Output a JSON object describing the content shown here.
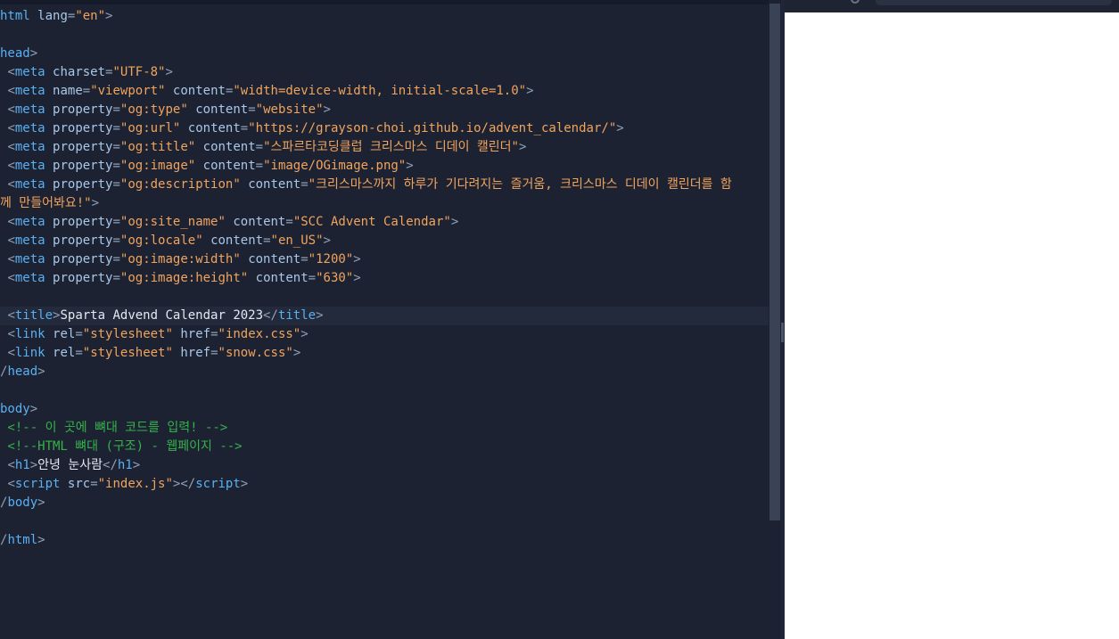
{
  "editor": {
    "lines": [
      [
        [
          "tag",
          "html"
        ],
        [
          "text",
          " "
        ],
        [
          "attr",
          "lang"
        ],
        [
          "punct",
          "="
        ],
        [
          "str",
          "\"en\""
        ],
        [
          "punct",
          ">"
        ]
      ],
      [],
      [
        [
          "tag",
          "head"
        ],
        [
          "punct",
          ">"
        ]
      ],
      [
        [
          "text",
          " "
        ],
        [
          "punct",
          "<"
        ],
        [
          "tag",
          "meta"
        ],
        [
          "text",
          " "
        ],
        [
          "attr",
          "charset"
        ],
        [
          "punct",
          "="
        ],
        [
          "str",
          "\"UTF-8\""
        ],
        [
          "punct",
          ">"
        ]
      ],
      [
        [
          "text",
          " "
        ],
        [
          "punct",
          "<"
        ],
        [
          "tag",
          "meta"
        ],
        [
          "text",
          " "
        ],
        [
          "attr",
          "name"
        ],
        [
          "punct",
          "="
        ],
        [
          "str",
          "\"viewport\""
        ],
        [
          "text",
          " "
        ],
        [
          "attr",
          "content"
        ],
        [
          "punct",
          "="
        ],
        [
          "str",
          "\"width=device-width, initial-scale=1.0\""
        ],
        [
          "punct",
          ">"
        ]
      ],
      [
        [
          "text",
          " "
        ],
        [
          "punct",
          "<"
        ],
        [
          "tag",
          "meta"
        ],
        [
          "text",
          " "
        ],
        [
          "attr",
          "property"
        ],
        [
          "punct",
          "="
        ],
        [
          "str",
          "\"og:type\""
        ],
        [
          "text",
          " "
        ],
        [
          "attr",
          "content"
        ],
        [
          "punct",
          "="
        ],
        [
          "str",
          "\"website\""
        ],
        [
          "punct",
          ">"
        ]
      ],
      [
        [
          "text",
          " "
        ],
        [
          "punct",
          "<"
        ],
        [
          "tag",
          "meta"
        ],
        [
          "text",
          " "
        ],
        [
          "attr",
          "property"
        ],
        [
          "punct",
          "="
        ],
        [
          "str",
          "\"og:url\""
        ],
        [
          "text",
          " "
        ],
        [
          "attr",
          "content"
        ],
        [
          "punct",
          "="
        ],
        [
          "str",
          "\"https://grayson-choi.github.io/advent_calendar/\""
        ],
        [
          "punct",
          ">"
        ]
      ],
      [
        [
          "text",
          " "
        ],
        [
          "punct",
          "<"
        ],
        [
          "tag",
          "meta"
        ],
        [
          "text",
          " "
        ],
        [
          "attr",
          "property"
        ],
        [
          "punct",
          "="
        ],
        [
          "str",
          "\"og:title\""
        ],
        [
          "text",
          " "
        ],
        [
          "attr",
          "content"
        ],
        [
          "punct",
          "="
        ],
        [
          "str",
          "\"스파르타코딩클럽 크리스마스 디데이 캘린더\""
        ],
        [
          "punct",
          ">"
        ]
      ],
      [
        [
          "text",
          " "
        ],
        [
          "punct",
          "<"
        ],
        [
          "tag",
          "meta"
        ],
        [
          "text",
          " "
        ],
        [
          "attr",
          "property"
        ],
        [
          "punct",
          "="
        ],
        [
          "str",
          "\"og:image\""
        ],
        [
          "text",
          " "
        ],
        [
          "attr",
          "content"
        ],
        [
          "punct",
          "="
        ],
        [
          "str",
          "\"image/OGimage.png\""
        ],
        [
          "punct",
          ">"
        ]
      ],
      [
        [
          "text",
          " "
        ],
        [
          "punct",
          "<"
        ],
        [
          "tag",
          "meta"
        ],
        [
          "text",
          " "
        ],
        [
          "attr",
          "property"
        ],
        [
          "punct",
          "="
        ],
        [
          "str",
          "\"og:description\""
        ],
        [
          "text",
          " "
        ],
        [
          "attr",
          "content"
        ],
        [
          "punct",
          "="
        ],
        [
          "str",
          "\"크리스마스까지 하루가 기다려지는 즐거움, 크리스마스 디데이 캘린더를 함"
        ]
      ],
      [
        [
          "str",
          "께 만들어봐요!\""
        ],
        [
          "punct",
          ">"
        ]
      ],
      [
        [
          "text",
          " "
        ],
        [
          "punct",
          "<"
        ],
        [
          "tag",
          "meta"
        ],
        [
          "text",
          " "
        ],
        [
          "attr",
          "property"
        ],
        [
          "punct",
          "="
        ],
        [
          "str",
          "\"og:site_name\""
        ],
        [
          "text",
          " "
        ],
        [
          "attr",
          "content"
        ],
        [
          "punct",
          "="
        ],
        [
          "str",
          "\"SCC Advent Calendar\""
        ],
        [
          "punct",
          ">"
        ]
      ],
      [
        [
          "text",
          " "
        ],
        [
          "punct",
          "<"
        ],
        [
          "tag",
          "meta"
        ],
        [
          "text",
          " "
        ],
        [
          "attr",
          "property"
        ],
        [
          "punct",
          "="
        ],
        [
          "str",
          "\"og:locale\""
        ],
        [
          "text",
          " "
        ],
        [
          "attr",
          "content"
        ],
        [
          "punct",
          "="
        ],
        [
          "str",
          "\"en_US\""
        ],
        [
          "punct",
          ">"
        ]
      ],
      [
        [
          "text",
          " "
        ],
        [
          "punct",
          "<"
        ],
        [
          "tag",
          "meta"
        ],
        [
          "text",
          " "
        ],
        [
          "attr",
          "property"
        ],
        [
          "punct",
          "="
        ],
        [
          "str",
          "\"og:image:width\""
        ],
        [
          "text",
          " "
        ],
        [
          "attr",
          "content"
        ],
        [
          "punct",
          "="
        ],
        [
          "str",
          "\"1200\""
        ],
        [
          "punct",
          ">"
        ]
      ],
      [
        [
          "text",
          " "
        ],
        [
          "punct",
          "<"
        ],
        [
          "tag",
          "meta"
        ],
        [
          "text",
          " "
        ],
        [
          "attr",
          "property"
        ],
        [
          "punct",
          "="
        ],
        [
          "str",
          "\"og:image:height\""
        ],
        [
          "text",
          " "
        ],
        [
          "attr",
          "content"
        ],
        [
          "punct",
          "="
        ],
        [
          "str",
          "\"630\""
        ],
        [
          "punct",
          ">"
        ]
      ],
      [],
      [
        [
          "text",
          " "
        ],
        [
          "punct",
          "<"
        ],
        [
          "tag",
          "title"
        ],
        [
          "punct",
          ">"
        ],
        [
          "text",
          "Sparta Advend Calendar 2023"
        ],
        [
          "punct",
          "</"
        ],
        [
          "tag",
          "title"
        ],
        [
          "punct",
          ">"
        ]
      ],
      [
        [
          "text",
          " "
        ],
        [
          "punct",
          "<"
        ],
        [
          "tag",
          "link"
        ],
        [
          "text",
          " "
        ],
        [
          "attr",
          "rel"
        ],
        [
          "punct",
          "="
        ],
        [
          "str",
          "\"stylesheet\""
        ],
        [
          "text",
          " "
        ],
        [
          "attr",
          "href"
        ],
        [
          "punct",
          "="
        ],
        [
          "str",
          "\"index.css\""
        ],
        [
          "punct",
          ">"
        ]
      ],
      [
        [
          "text",
          " "
        ],
        [
          "punct",
          "<"
        ],
        [
          "tag",
          "link"
        ],
        [
          "text",
          " "
        ],
        [
          "attr",
          "rel"
        ],
        [
          "punct",
          "="
        ],
        [
          "str",
          "\"stylesheet\""
        ],
        [
          "text",
          " "
        ],
        [
          "attr",
          "href"
        ],
        [
          "punct",
          "="
        ],
        [
          "str",
          "\"snow.css\""
        ],
        [
          "punct",
          ">"
        ]
      ],
      [
        [
          "punct",
          "/"
        ],
        [
          "tag",
          "head"
        ],
        [
          "punct",
          ">"
        ]
      ],
      [],
      [
        [
          "tag",
          "body"
        ],
        [
          "punct",
          ">"
        ]
      ],
      [
        [
          "comment",
          " <!-- 이 곳에 뼈대 코드를 입력! -->"
        ]
      ],
      [
        [
          "comment",
          " <!--HTML 뼈대 (구조) - 웹페이지 -->"
        ]
      ],
      [
        [
          "text",
          " "
        ],
        [
          "punct",
          "<"
        ],
        [
          "tag",
          "h1"
        ],
        [
          "punct",
          ">"
        ],
        [
          "text",
          "안녕 눈사람"
        ],
        [
          "punct",
          "</"
        ],
        [
          "tag",
          "h1"
        ],
        [
          "punct",
          ">"
        ]
      ],
      [
        [
          "text",
          " "
        ],
        [
          "punct",
          "<"
        ],
        [
          "tag",
          "script"
        ],
        [
          "text",
          " "
        ],
        [
          "attr",
          "src"
        ],
        [
          "punct",
          "="
        ],
        [
          "str",
          "\"index.js\""
        ],
        [
          "punct",
          "></"
        ],
        [
          "tag",
          "script"
        ],
        [
          "punct",
          ">"
        ]
      ],
      [
        [
          "punct",
          "/"
        ],
        [
          "tag",
          "body"
        ],
        [
          "punct",
          ">"
        ]
      ],
      [],
      [
        [
          "punct",
          "/"
        ],
        [
          "tag",
          "html"
        ],
        [
          "punct",
          ">"
        ]
      ]
    ],
    "active_line": 16
  }
}
